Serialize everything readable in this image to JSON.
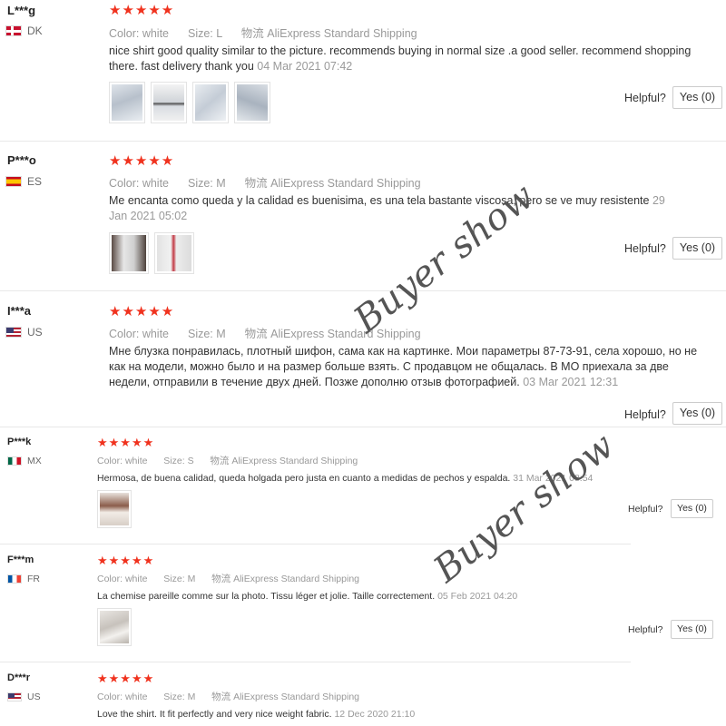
{
  "labels": {
    "color": "Color:",
    "size": "Size:",
    "shipping_prefix": "物流",
    "helpful": "Helpful?"
  },
  "reviews": [
    {
      "user": "L***g",
      "country": "DK",
      "flag": "denmark",
      "stars": "★★★★★",
      "color": "white",
      "size": "L",
      "shipping": "AliExpress Standard Shipping",
      "text": "nice shirt good quality similar to the picture. recommends buying in normal size .a good seller. recommend shopping there. fast delivery thank you",
      "date": "04 Mar 2021 07:42",
      "photo_count": 4,
      "yes": "Yes (0)"
    },
    {
      "user": "P***o",
      "country": "ES",
      "flag": "spain",
      "stars": "★★★★★",
      "color": "white",
      "size": "M",
      "shipping": "AliExpress Standard Shipping",
      "text": "Me encanta como queda y la calidad es buenisima, es una tela bastante viscosa, pero se ve muy resistente",
      "date": "29 Jan 2021 05:02",
      "photo_count": 2,
      "yes": "Yes (0)"
    },
    {
      "user": "I***a",
      "country": "US",
      "flag": "usa",
      "stars": "★★★★★",
      "color": "white",
      "size": "M",
      "shipping": "AliExpress Standard Shipping",
      "text": "Мне блузка понравилась, плотный шифон, сама как на картинке. Мои параметры 87-73-91, села хорошо, но не как на модели, можно было и на размер больше взять. С продавцом не общалась. В МО приехала за две недели, отправили в течение двух дней. Позже дополню отзыв фотографией.",
      "date": "03 Mar 2021 12:31",
      "photo_count": 0,
      "yes": "Yes (0)"
    },
    {
      "user": "P***k",
      "country": "MX",
      "flag": "mexico",
      "stars": "★★★★★",
      "color": "white",
      "size": "S",
      "shipping": "AliExpress Standard Shipping",
      "text": "Hermosa, de buena calidad, queda holgada pero justa en cuanto a medidas de pechos y espalda.",
      "date": "31 Mar 2021 08:54",
      "photo_count": 1,
      "yes": "Yes (0)"
    },
    {
      "user": "F***m",
      "country": "FR",
      "flag": "france",
      "stars": "★★★★★",
      "color": "white",
      "size": "M",
      "shipping": "AliExpress Standard Shipping",
      "text": "La chemise pareille comme sur la photo. Tissu léger et jolie. Taille correctement.",
      "date": "05 Feb 2021 04:20",
      "photo_count": 1,
      "yes": "Yes (0)"
    },
    {
      "user": "D***r",
      "country": "US",
      "flag": "usa",
      "stars": "★★★★★",
      "color": "white",
      "size": "M",
      "shipping": "AliExpress Standard Shipping",
      "text": "Love the shirt. It fit perfectly and very nice weight fabric.",
      "date": "12 Dec 2020 21:10",
      "photo_count": 0,
      "yes": ""
    }
  ],
  "watermarks": [
    "Buyer show",
    "Buyer show"
  ],
  "colors": {
    "stars": "#f0321e",
    "meta": "#999999",
    "text": "#333333"
  }
}
